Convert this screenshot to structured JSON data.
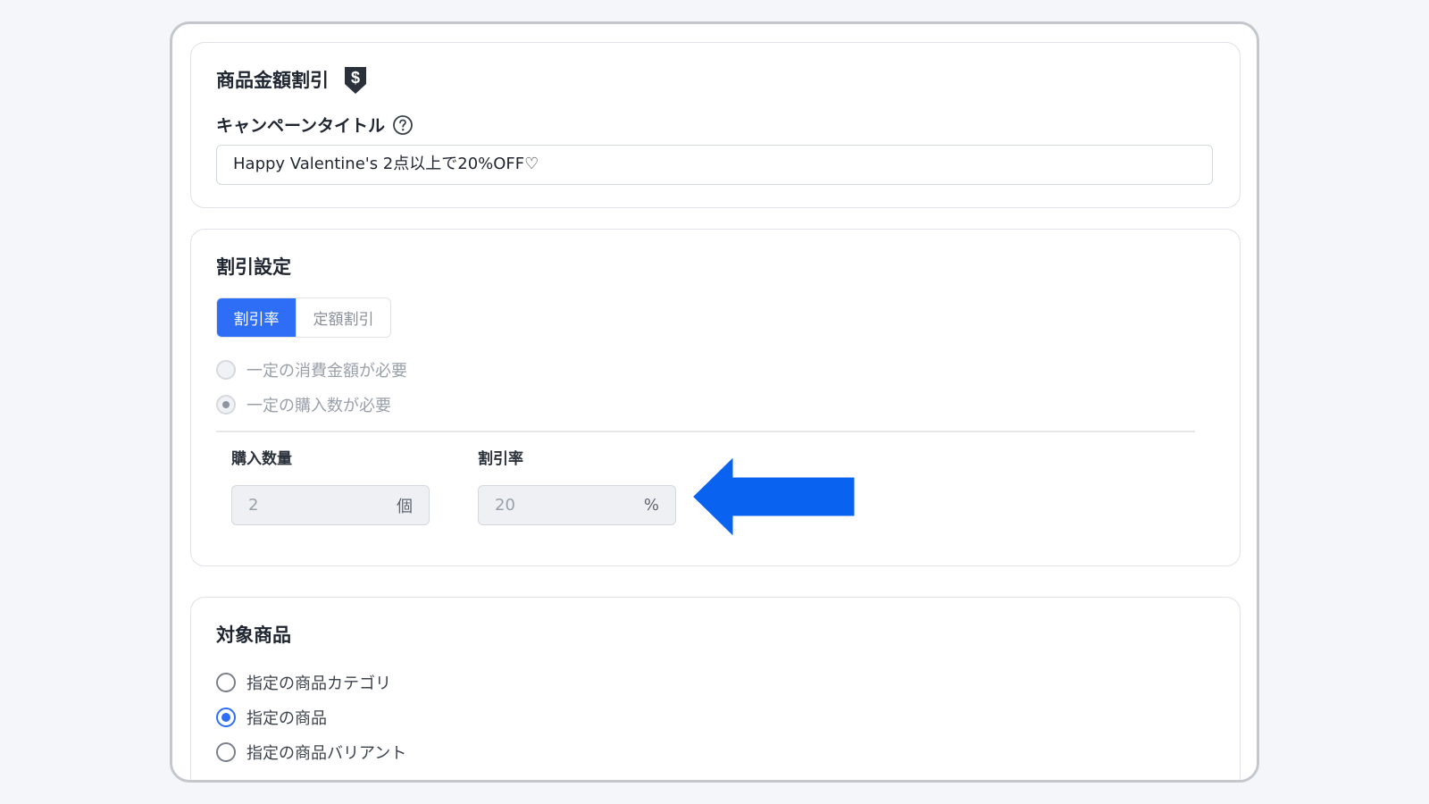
{
  "discount_section": {
    "title": "商品金額割引",
    "icon": "dollar-down-icon",
    "campaign_title_label": "キャンペーンタイトル",
    "campaign_title_value": "Happy Valentine's 2点以上で20%OFF♡"
  },
  "discount_settings": {
    "title": "割引設定",
    "tabs": [
      {
        "label": "割引率",
        "active": true
      },
      {
        "label": "定額割引",
        "active": false
      }
    ],
    "conditions": [
      {
        "label": "一定の消費金額が必要",
        "checked": false
      },
      {
        "label": "一定の購入数が必要",
        "checked": true
      }
    ],
    "quantity_label": "購入数量",
    "quantity_value": "2",
    "quantity_unit": "個",
    "rate_label": "割引率",
    "rate_value": "20",
    "rate_unit": "%"
  },
  "target_products": {
    "title": "対象商品",
    "options": [
      {
        "label": "指定の商品カテゴリ",
        "checked": false
      },
      {
        "label": "指定の商品",
        "checked": true
      },
      {
        "label": "指定の商品バリアント",
        "checked": false
      }
    ]
  },
  "colors": {
    "accent": "#2e6ef7",
    "arrow": "#0a62f0"
  }
}
